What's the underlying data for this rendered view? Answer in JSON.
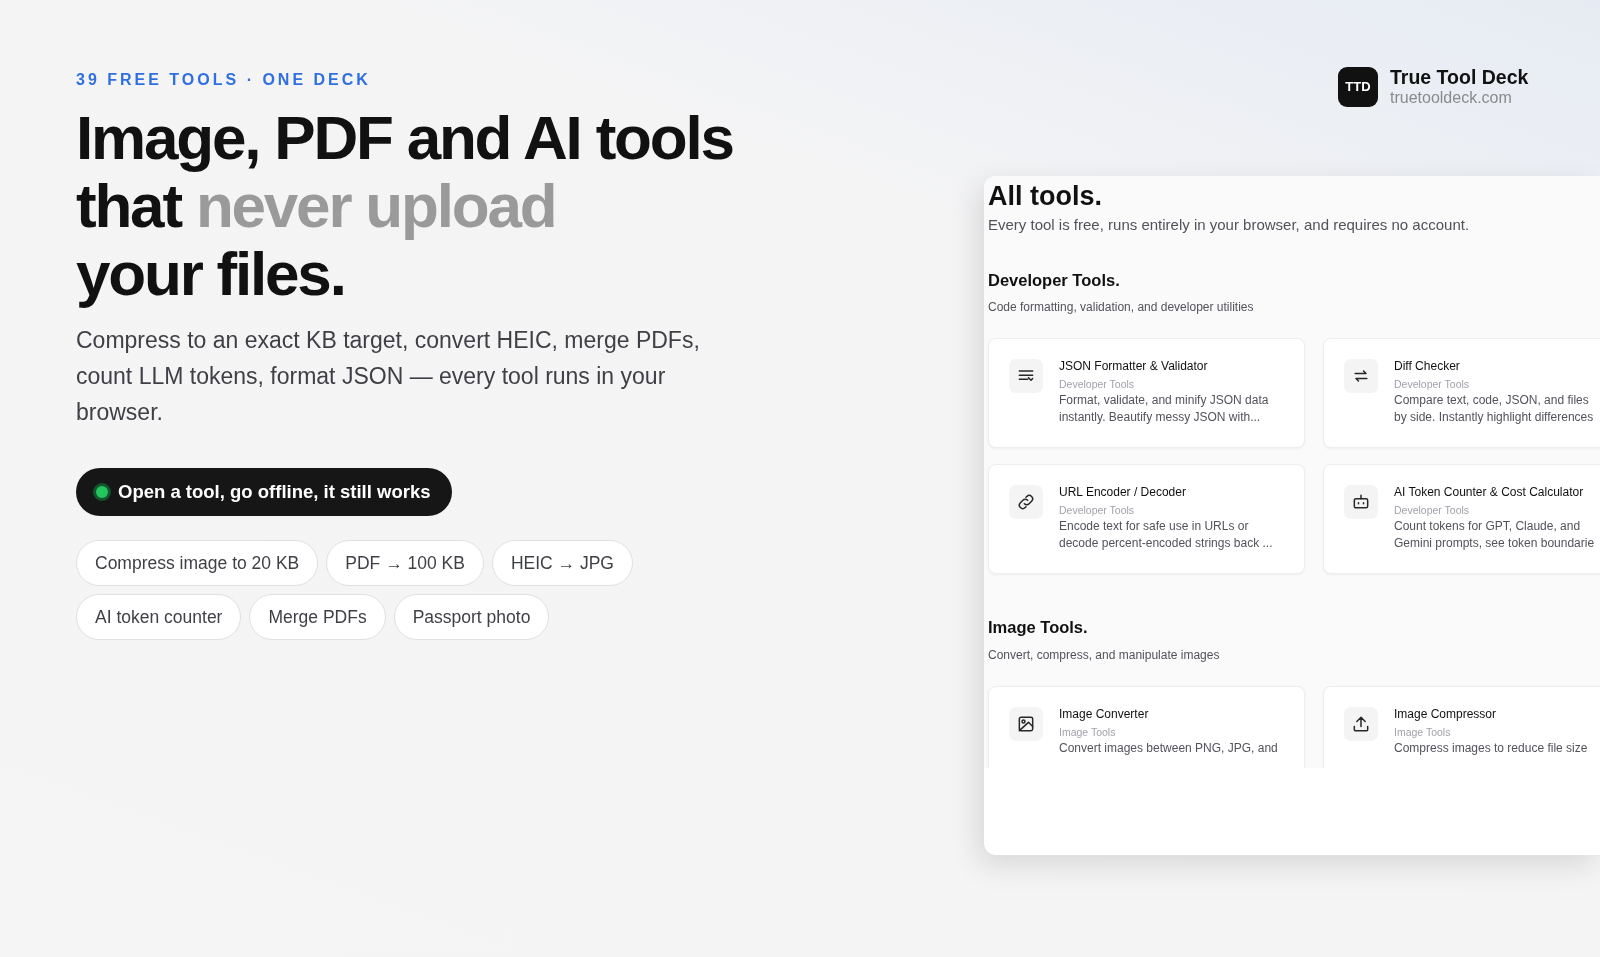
{
  "brand": {
    "logo": "TTD",
    "name": "True Tool Deck",
    "domain": "truetooldeck.com"
  },
  "hero": {
    "eyebrow": "39 FREE TOOLS · ONE DECK",
    "headline": [
      [
        {
          "text": "Image, PDF and AI tools",
          "muted": false
        }
      ],
      [
        {
          "text": "that ",
          "muted": false
        },
        {
          "text": "never upload",
          "muted": true
        }
      ],
      [
        {
          "text": "your files.",
          "muted": false
        }
      ]
    ],
    "lead": "Compress to an exact KB target, convert HEIC, merge PDFs, count LLM tokens, format JSON — every tool runs in your browser.",
    "status": {
      "label": "Open a tool, go offline, it still works",
      "online": true
    },
    "chip_rows": [
      [
        "Compress image to 20 KB",
        "PDF → 100 KB",
        "HEIC → JPG"
      ],
      [
        "AI token counter",
        "Merge PDFs",
        "Passport photo"
      ]
    ]
  },
  "preview": {
    "title": "All tools.",
    "subtitle": "Every tool is free, runs entirely in your browser, and requires no account.",
    "sections": [
      {
        "title": "Developer Tools.",
        "subtitle": "Code formatting, validation, and developer utilities",
        "tools": [
          {
            "name": "JSON Formatter & Validator",
            "category": "Developer Tools",
            "description": [
              "Format, validate, and minify JSON data",
              "instantly. Beautify messy JSON with..."
            ]
          },
          {
            "name": "Diff Checker",
            "category": "Developer Tools",
            "description": [
              "Compare text, code, JSON, and files",
              "by side. Instantly highlight differences"
            ]
          },
          {
            "name": "URL Encoder / Decoder",
            "category": "Developer Tools",
            "description": [
              "Encode text for safe use in URLs or",
              "decode percent-encoded strings back ..."
            ]
          },
          {
            "name": "AI Token Counter & Cost Calculator",
            "category": "Developer Tools",
            "description": [
              "Count tokens for GPT, Claude, and",
              "Gemini prompts, see token boundarie"
            ]
          }
        ]
      },
      {
        "title": "Image Tools.",
        "subtitle": "Convert, compress, and manipulate images",
        "tools": [
          {
            "name": "Image Converter",
            "category": "Image Tools",
            "description": [
              "Convert images between PNG, JPG, and"
            ]
          },
          {
            "name": "Image Compressor",
            "category": "Image Tools",
            "description": [
              "Compress images to reduce file size"
            ]
          }
        ]
      }
    ]
  }
}
